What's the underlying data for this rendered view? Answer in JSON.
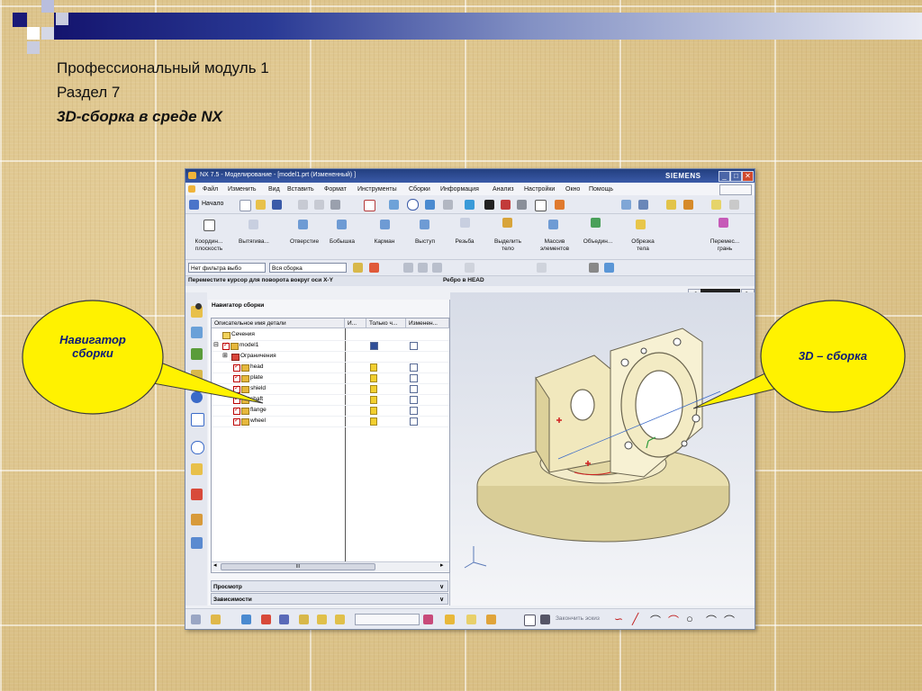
{
  "slide": {
    "line1": "Профессиональный модуль 1",
    "line2": "Раздел 7",
    "line3": "3D-сборка в среде NX"
  },
  "window": {
    "title": "NX 7.5 - Моделирование - [model1.prt (Измененный) ]",
    "brand": "SIEMENS",
    "minimize": "_",
    "maximize": "□",
    "close": "✕"
  },
  "menu": [
    "Файл",
    "Изменить",
    "Вид",
    "Вставить",
    "Формат",
    "Инструменты",
    "Сборки",
    "Информация",
    "Анализ",
    "Настройки",
    "Окно",
    "Помощь"
  ],
  "toolbar": {
    "start_label": "Начало",
    "features": [
      {
        "label": "Координ...\nплоскость"
      },
      {
        "label": "Вытягива..."
      },
      {
        "label": "Отверстие"
      },
      {
        "label": "Бобышка"
      },
      {
        "label": "Карман"
      },
      {
        "label": "Выступ"
      },
      {
        "label": "Резьба"
      },
      {
        "label": "Выделить\nтело"
      },
      {
        "label": "Массив\nэлементов"
      },
      {
        "label": "Объедин..."
      },
      {
        "label": "Обрезка\nтела"
      },
      {
        "label": "Перемес...\nгрань"
      }
    ],
    "filter_value": "Нет фильтра выбо",
    "assembly_value": "Вся сборка"
  },
  "status": {
    "left": "Переместите курсор для поворота вокруг оси X-Y",
    "right": "Ребро в HEAD"
  },
  "navigator": {
    "title": "Навигатор сборки",
    "columns": [
      "Описательное имя детали",
      "И...",
      "Только ч...",
      "Изменен..."
    ],
    "rows": [
      {
        "name": "Сечения"
      },
      {
        "name": "model1"
      },
      {
        "name": "Ограничения"
      },
      {
        "name": "head"
      },
      {
        "name": "plate"
      },
      {
        "name": "shield"
      },
      {
        "name": "shaft"
      },
      {
        "name": "flange"
      },
      {
        "name": "wheel"
      }
    ],
    "panel1": "Просмотр",
    "panel2": "Зависимости",
    "scroll_mark": "III"
  },
  "bottom_toolbar": {
    "finish_sketch": "Закончить эскиз"
  },
  "callouts": {
    "left": "Навигатор\nсборки",
    "right": "3D – сборка"
  },
  "colors": {
    "callout_fill": "#fff200",
    "callout_text": "#0b1a7a",
    "title_bar": "#233f80",
    "model": "#f6efc8"
  }
}
